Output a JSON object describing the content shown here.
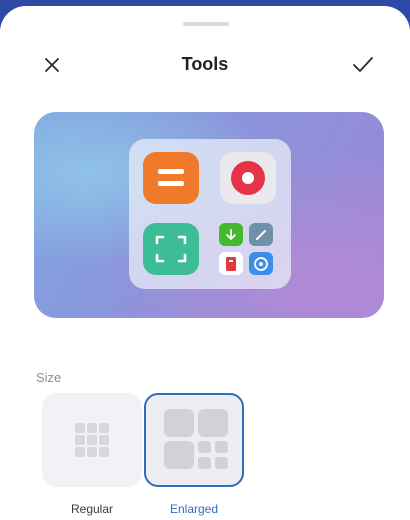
{
  "header": {
    "title": "Tools",
    "close_icon": "close-icon",
    "confirm_icon": "checkmark-icon"
  },
  "preview": {
    "apps": [
      "notes-app-icon",
      "recorder-app-icon",
      "scanner-app-icon",
      "download-app-icon",
      "pen-app-icon",
      "book-app-icon",
      "compass-app-icon"
    ]
  },
  "size": {
    "label": "Size",
    "options": [
      {
        "label": "Regular",
        "selected": false
      },
      {
        "label": "Enlarged",
        "selected": true
      }
    ]
  },
  "colors": {
    "accent": "#2f6fb8",
    "top_bar": "#2e49a6",
    "notes": "#f07a2a",
    "recorder": "#e63347",
    "scanner": "#3dbd95"
  }
}
